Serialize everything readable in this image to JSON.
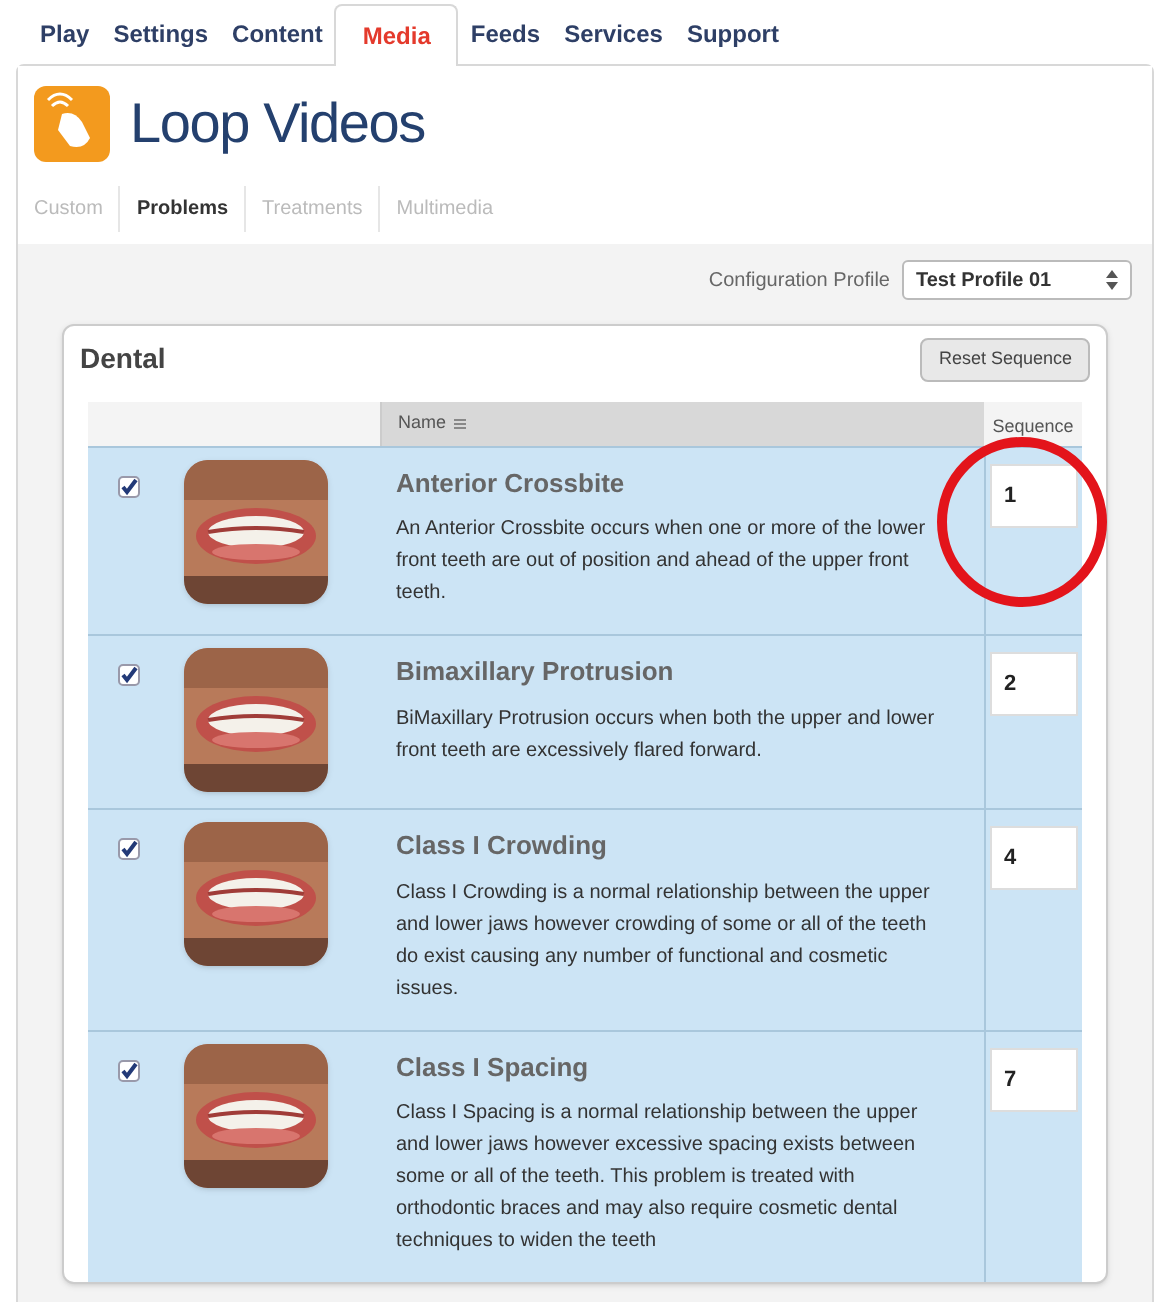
{
  "top_tabs": [
    {
      "label": "Play",
      "selected": false
    },
    {
      "label": "Settings",
      "selected": false
    },
    {
      "label": "Content",
      "selected": false
    },
    {
      "label": "Media",
      "selected": true
    },
    {
      "label": "Feeds",
      "selected": false
    },
    {
      "label": "Services",
      "selected": false
    },
    {
      "label": "Support",
      "selected": false
    }
  ],
  "page_title": "Loop Videos",
  "sub_tabs": [
    {
      "label": "Custom",
      "selected": false
    },
    {
      "label": "Problems",
      "selected": true
    },
    {
      "label": "Treatments",
      "selected": false
    },
    {
      "label": "Multimedia",
      "selected": false
    }
  ],
  "configuration_profile": {
    "label": "Configuration Profile",
    "value": "Test Profile 01"
  },
  "panel": {
    "title": "Dental",
    "reset_button": "Reset Sequence",
    "columns": {
      "name": "Name",
      "sequence": "Sequence"
    },
    "rows": [
      {
        "checked": true,
        "name": "Anterior Crossbite",
        "description": "An Anterior Crossbite occurs when one or more of the lower front teeth are out of position and ahead of the upper front teeth.",
        "sequence": "1"
      },
      {
        "checked": true,
        "name": "Bimaxillary Protrusion",
        "description": "BiMaxillary Protrusion occurs when both the upper and lower front teeth are excessively flared forward.",
        "sequence": "2"
      },
      {
        "checked": true,
        "name": "Class I Crowding",
        "description": "Class I Crowding is a normal relationship between the upper and lower jaws however crowding of some or all of the teeth do exist causing any number of functional and cosmetic issues.",
        "sequence": "4"
      },
      {
        "checked": true,
        "name": "Class I Spacing",
        "description": "Class I Spacing is a normal relationship between the upper and lower jaws however excessive spacing exists between some or all of the teeth. This problem is treated with orthodontic braces and may also require cosmetic dental techniques to widen the teeth",
        "sequence": "7"
      }
    ]
  }
}
